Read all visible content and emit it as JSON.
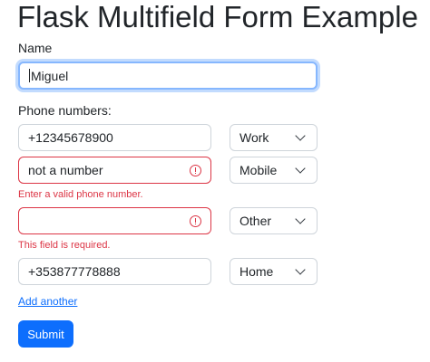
{
  "page": {
    "title": "Flask Multifield Form Example"
  },
  "form": {
    "name_label": "Name",
    "name_value": "Miguel",
    "phones_label": "Phone numbers:",
    "phones": [
      {
        "number": "+12345678900",
        "type": "Work",
        "error": ""
      },
      {
        "number": "not a number",
        "type": "Mobile",
        "error": "Enter a valid phone number."
      },
      {
        "number": "",
        "type": "Other",
        "error": "This field is required."
      },
      {
        "number": "+353877778888",
        "type": "Home",
        "error": ""
      }
    ],
    "add_another": "Add another",
    "submit": "Submit"
  },
  "colors": {
    "primary": "#0d6efd",
    "danger": "#dc3545",
    "focus_border": "#86b7fe"
  }
}
